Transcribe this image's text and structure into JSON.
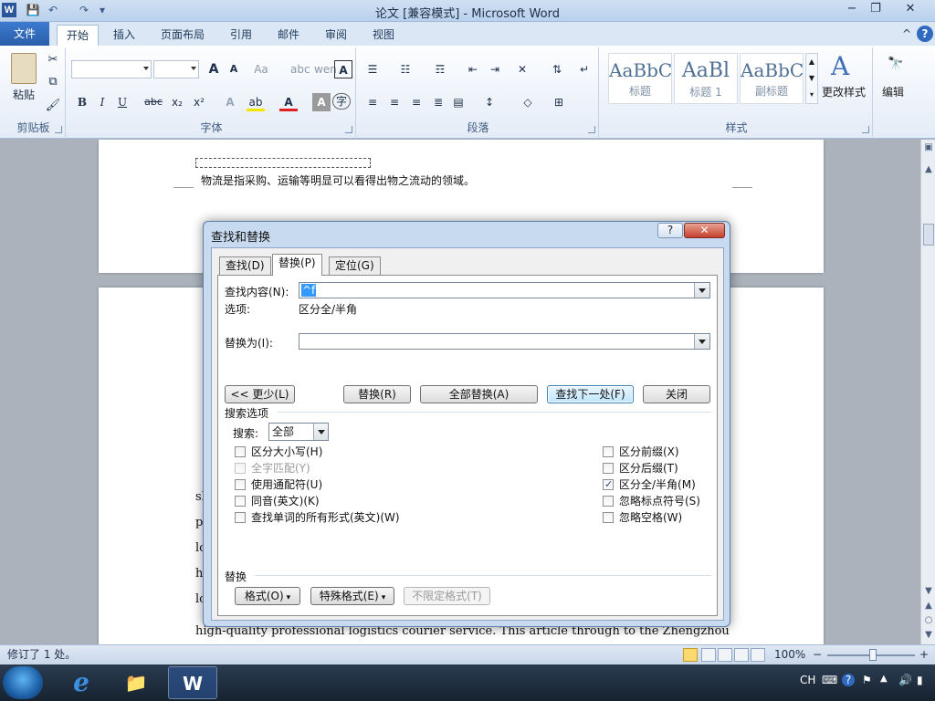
{
  "window": {
    "title": "论文 [兼容模式] - Microsoft Word",
    "logo": "W",
    "min": "−",
    "restore": "❐",
    "close": "✕"
  },
  "qat": {
    "save": "💾",
    "undo": "↶",
    "redo": "↷",
    "more": "▾"
  },
  "ribbon_tabs": [
    "文件",
    "开始",
    "插入",
    "页面布局",
    "引用",
    "邮件",
    "审阅",
    "视图"
  ],
  "ribbon_help": {
    "minimize": "^",
    "help": "?"
  },
  "ribbon": {
    "clipboard": {
      "label": "剪贴板",
      "paste": "粘贴"
    },
    "font": {
      "label": "字体",
      "font_name": "",
      "font_size": "",
      "grow": "A",
      "shrink": "A",
      "case": "Aa",
      "bold": "B",
      "italic": "I",
      "underline": "U",
      "strike": "abc",
      "sub": "x₂",
      "sup": "x²",
      "font_color": "A",
      "char_shading": "A"
    },
    "paragraph": {
      "label": "段落"
    },
    "styles": {
      "label": "样式",
      "items": [
        {
          "sample": "AaBbC",
          "name": "标题"
        },
        {
          "sample": "AaBl",
          "name": "标题 1"
        },
        {
          "sample": "AaBbC",
          "name": "副标题"
        }
      ],
      "change_styles": "更改样式"
    },
    "editing": {
      "label": "编辑"
    }
  },
  "document": {
    "line1": "物流是指采购、运输等明显可以看得出物之流动的领域。",
    "english_lines": [
      "sh",
      "p",
      "lo",
      "h",
      "lo",
      "high-quality professional logistics courier service. This article through to the Zhengzhou"
    ]
  },
  "dialog": {
    "title": "查找和替换",
    "help": "?",
    "close": "✕",
    "tabs": [
      "查找(D)",
      "替换(P)",
      "定位(G)"
    ],
    "find_label": "查找内容(N):",
    "find_value": "^f",
    "options_label": "选项:",
    "options_value": "区分全/半角",
    "replace_label": "替换为(I):",
    "replace_value": "",
    "buttons": {
      "less": "<< 更少(L)",
      "replace": "替换(R)",
      "replace_all": "全部替换(A)",
      "find_next": "查找下一处(F)",
      "close": "关闭"
    },
    "search_options_label": "搜索选项",
    "search_label": "搜索:",
    "search_value": "全部",
    "left_checks": [
      {
        "label": "区分大小写(H)",
        "checked": false,
        "disabled": false
      },
      {
        "label": "全字匹配(Y)",
        "checked": false,
        "disabled": true
      },
      {
        "label": "使用通配符(U)",
        "checked": false,
        "disabled": false
      },
      {
        "label": "同音(英文)(K)",
        "checked": false,
        "disabled": false
      },
      {
        "label": "查找单词的所有形式(英文)(W)",
        "checked": false,
        "disabled": false
      }
    ],
    "right_checks": [
      {
        "label": "区分前缀(X)",
        "checked": false
      },
      {
        "label": "区分后缀(T)",
        "checked": false
      },
      {
        "label": "区分全/半角(M)",
        "checked": true
      },
      {
        "label": "忽略标点符号(S)",
        "checked": false
      },
      {
        "label": "忽略空格(W)",
        "checked": false
      }
    ],
    "replace_section_label": "替换",
    "format_btn": "格式(O)",
    "special_btn": "特殊格式(E)",
    "no_format_btn": "不限定格式(T)"
  },
  "status": {
    "revisions": "修订了 1 处。",
    "zoom": "100%",
    "zoom_out": "−",
    "zoom_in": "+"
  },
  "taskbar": {
    "tray_lang": "CH",
    "apps": [
      "e",
      "📁",
      "W"
    ]
  }
}
